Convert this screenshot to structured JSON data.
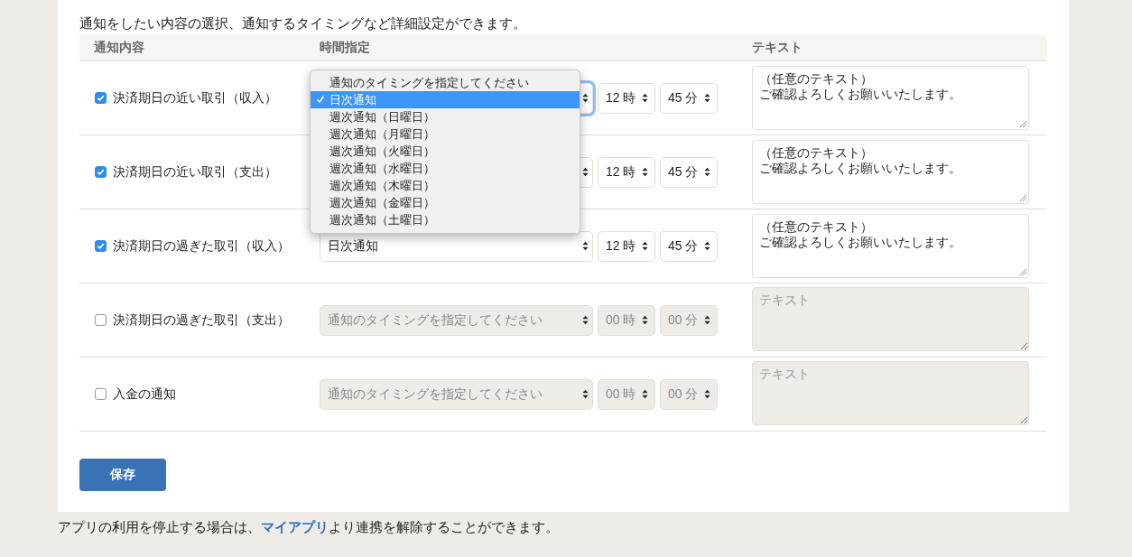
{
  "intro": "通知をしたい内容の選択、通知するタイミングなど詳細設定ができます。",
  "columns": [
    "通知内容",
    "時間指定",
    "テキスト"
  ],
  "rows": [
    {
      "label": "決済期日の近い取引（収入）",
      "checked": true,
      "hour": "12 時",
      "minute": "45 分",
      "text_lines": [
        "（任意のテキスト）",
        "ご確認よろしくお願いいたします。"
      ],
      "focused": true,
      "menu": [
        {
          "label": "通知のタイミングを指定してください",
          "selected": false
        },
        {
          "label": "日次通知",
          "selected": true
        },
        {
          "label": "週次通知（日曜日）",
          "selected": false
        },
        {
          "label": "週次通知（月曜日）",
          "selected": false
        },
        {
          "label": "週次通知（火曜日）",
          "selected": false
        },
        {
          "label": "週次通知（水曜日）",
          "selected": false
        },
        {
          "label": "週次通知（木曜日）",
          "selected": false
        },
        {
          "label": "週次通知（金曜日）",
          "selected": false
        },
        {
          "label": "週次通知（土曜日）",
          "selected": false
        }
      ]
    },
    {
      "label": "決済期日の近い取引（支出）",
      "checked": true,
      "hour": "12 時",
      "minute": "45 分",
      "text_lines": [
        "（任意のテキスト）",
        "ご確認よろしくお願いいたします。"
      ],
      "focused": false
    },
    {
      "label": "決済期日の過ぎた取引（収入）",
      "checked": true,
      "timing": "日次通知",
      "hour": "12 時",
      "minute": "45 分",
      "text_lines": [
        "（任意のテキスト）",
        "ご確認よろしくお願いいたします。"
      ],
      "focused": false
    },
    {
      "label": "決済期日の過ぎた取引（支出）",
      "checked": false,
      "timing": "通知のタイミングを指定してください",
      "hour": "00 時",
      "minute": "00 分",
      "placeholder": "テキスト",
      "focused": false
    },
    {
      "label": "入金の通知",
      "checked": false,
      "timing": "通知のタイミングを指定してください",
      "hour": "00 時",
      "minute": "00 分",
      "placeholder": "テキスト",
      "focused": false
    }
  ],
  "save_button": "保存",
  "footer": {
    "before": "アプリの利用を停止する場合は、",
    "link": "マイアプリ",
    "after": "より連携を解除することができます。"
  }
}
